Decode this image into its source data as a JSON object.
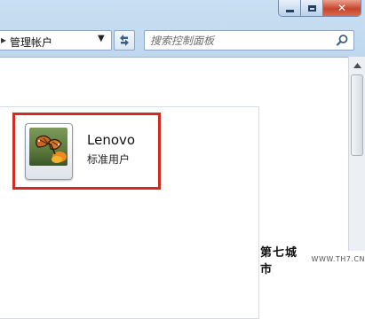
{
  "window": {
    "minimize_icon": "minimize-icon",
    "maximize_icon": "maximize-icon",
    "close_icon": "close-icon"
  },
  "address_bar": {
    "separator": "▸",
    "breadcrumb": "管理帐户",
    "dropdown_icon": "chevron-down-icon",
    "refresh_icon": "refresh-icon"
  },
  "search": {
    "placeholder": "搜索控制面板",
    "icon": "search-icon"
  },
  "account": {
    "name": "Lenovo",
    "role": "标准用户",
    "picture": "butterfly-flower-picture",
    "highlight_color": "#d22b22"
  },
  "watermark": {
    "main": "第七城市",
    "sub": "WWW.TH7.CN"
  }
}
